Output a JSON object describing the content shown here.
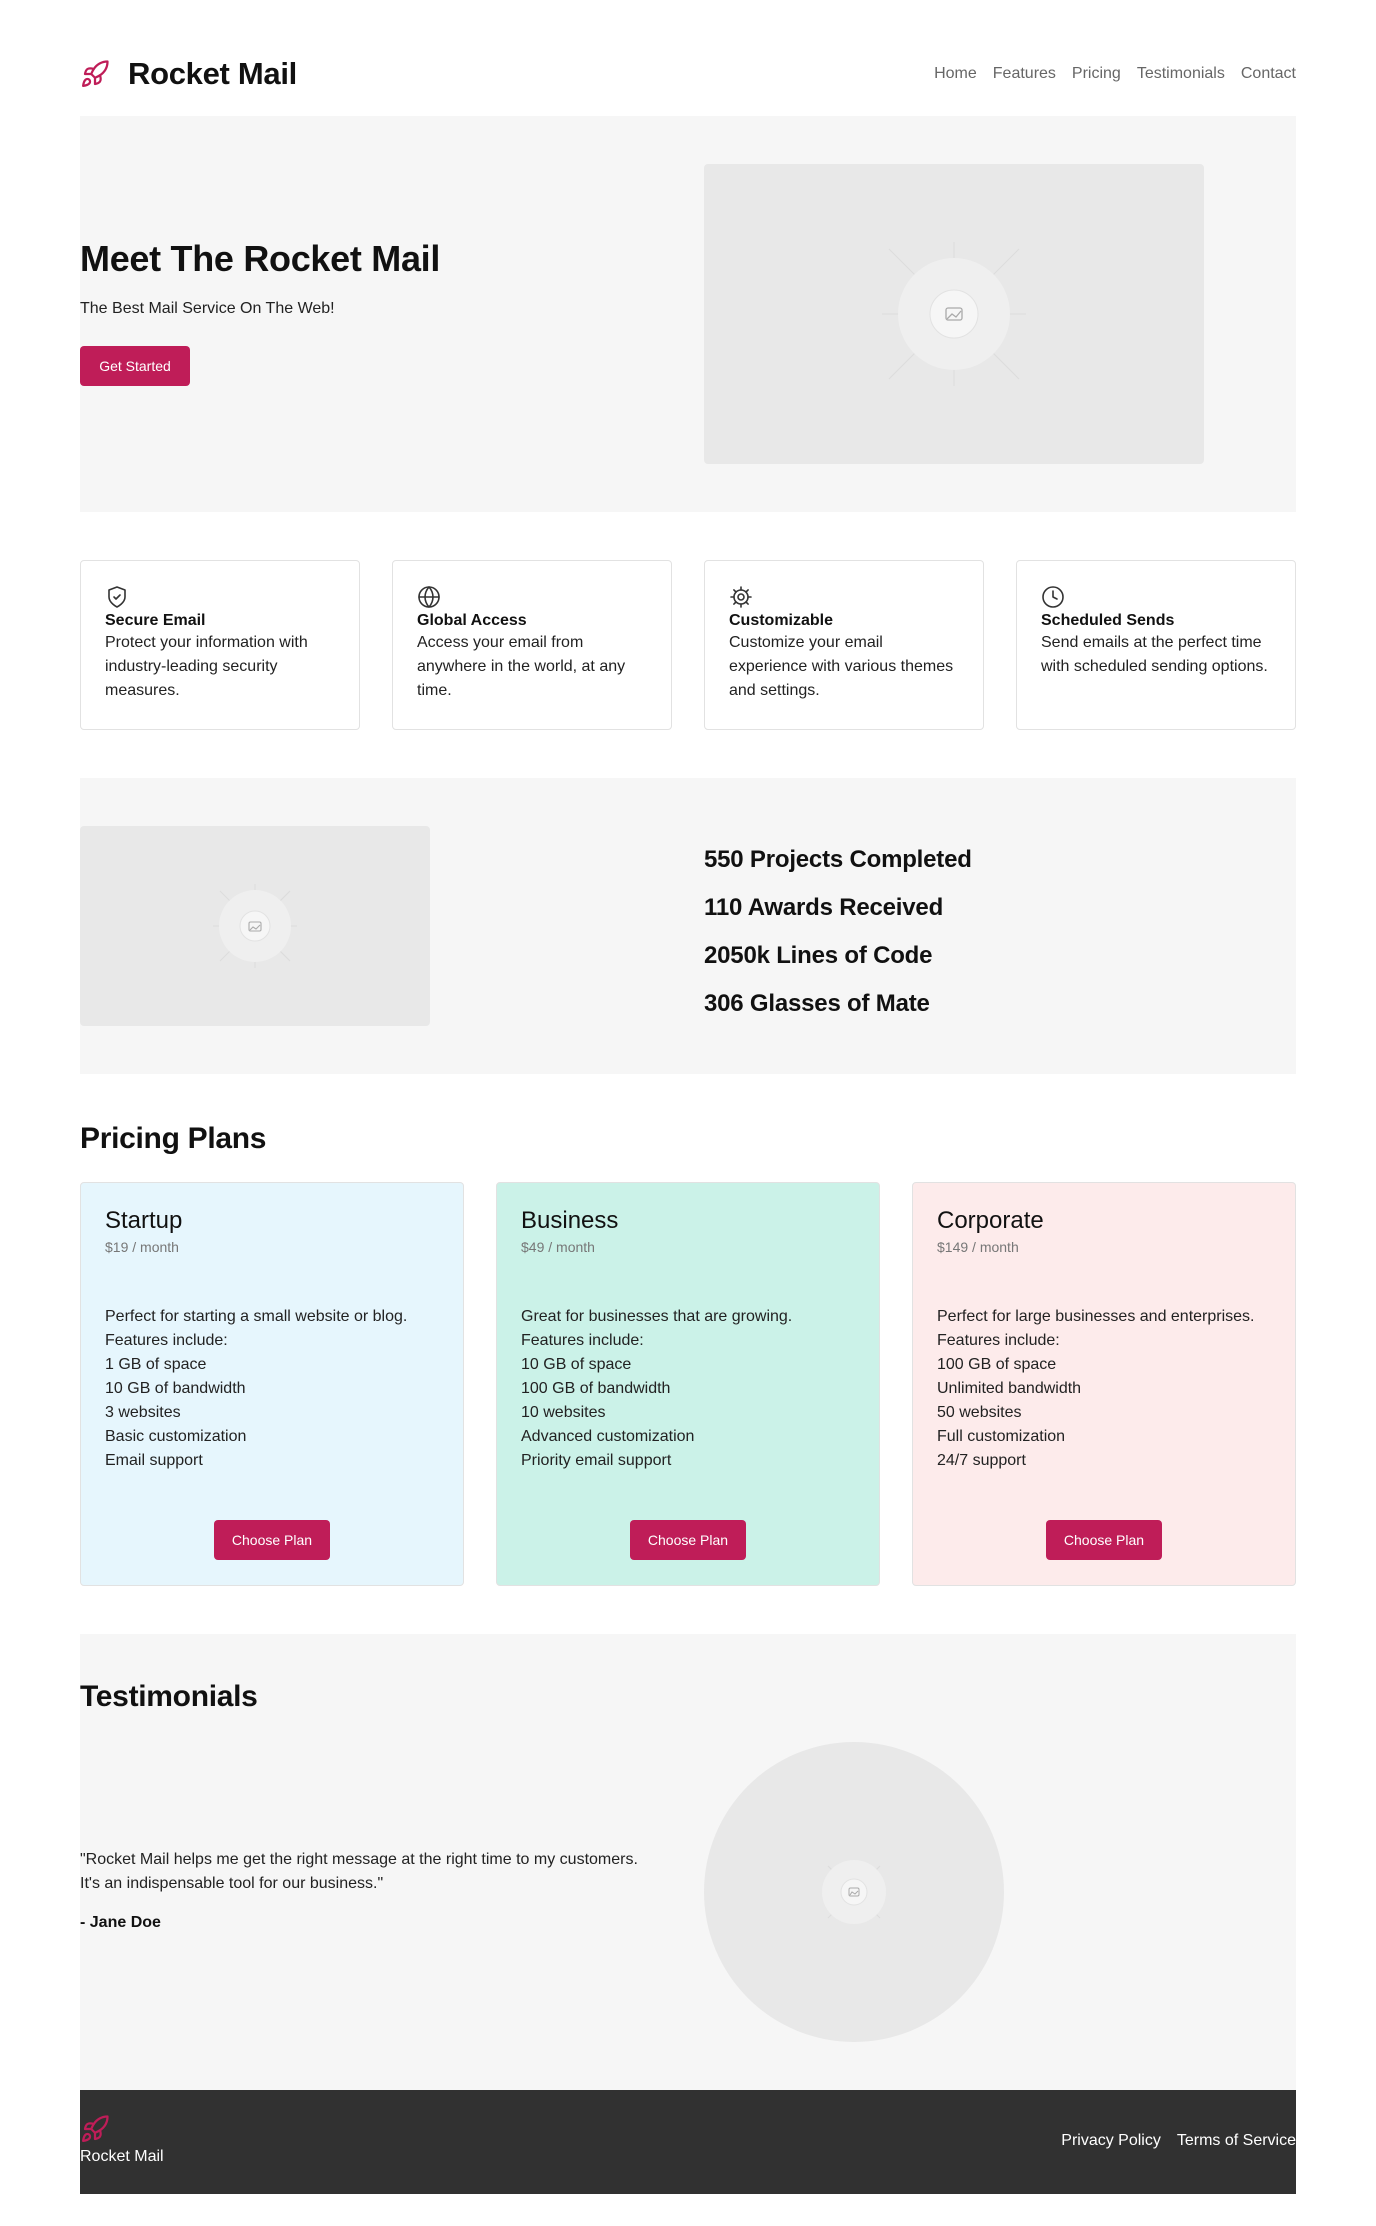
{
  "brand": {
    "name": "Rocket Mail",
    "logo_icon": "rocket-icon",
    "accent": "#bf1d58"
  },
  "nav": {
    "items": [
      {
        "label": "Home"
      },
      {
        "label": "Features"
      },
      {
        "label": "Pricing"
      },
      {
        "label": "Testimonials"
      },
      {
        "label": "Contact"
      }
    ]
  },
  "hero": {
    "title": "Meet The Rocket Mail",
    "subtitle": "The Best Mail Service On The Web!",
    "cta_label": "Get Started",
    "image_icon": "image-placeholder-icon"
  },
  "features": [
    {
      "icon": "shield-icon",
      "title": "Secure Email",
      "text": "Protect your information with industry-leading security measures."
    },
    {
      "icon": "globe-icon",
      "title": "Global Access",
      "text": "Access your email from anywhere in the world, at any time."
    },
    {
      "icon": "gear-icon",
      "title": "Customizable",
      "text": "Customize your email experience with various themes and settings."
    },
    {
      "icon": "clock-icon",
      "title": "Scheduled Sends",
      "text": "Send emails at the perfect time with scheduled sending options."
    }
  ],
  "stats": [
    {
      "text": "550 Projects Completed"
    },
    {
      "text": "110 Awards Received"
    },
    {
      "text": "2050k Lines of Code"
    },
    {
      "text": "306 Glasses of Mate"
    }
  ],
  "pricing": {
    "title": "Pricing Plans",
    "plans": [
      {
        "name": "Startup",
        "price": "$19 / month",
        "bg": "#e6f6fd",
        "lines": [
          "Perfect for starting a small website or blog. Features include:",
          "1 GB of space",
          "10 GB of bandwidth",
          "3 websites",
          "Basic customization",
          "Email support"
        ],
        "button": "Choose Plan"
      },
      {
        "name": "Business",
        "price": "$49 / month",
        "bg": "#cbf2e8",
        "lines": [
          "Great for businesses that are growing. Features include:",
          "10 GB of space",
          "100 GB of bandwidth",
          "10 websites",
          "Advanced customization",
          "Priority email support"
        ],
        "button": "Choose Plan"
      },
      {
        "name": "Corporate",
        "price": "$149 / month",
        "bg": "#fdebeb",
        "lines": [
          "Perfect for large businesses and enterprises. Features include:",
          "100 GB of space",
          "Unlimited bandwidth",
          "50 websites",
          "Full customization",
          "24/7 support"
        ],
        "button": "Choose Plan"
      }
    ]
  },
  "testimonials": {
    "title": "Testimonials",
    "quote": "\"Rocket Mail helps me get the right message at the right time to my customers. It's an indispensable tool for our business.\"",
    "author": "- Jane Doe"
  },
  "footer": {
    "name": "Rocket Mail",
    "links": [
      {
        "label": "Privacy Policy"
      },
      {
        "label": "Terms of Service"
      }
    ]
  }
}
